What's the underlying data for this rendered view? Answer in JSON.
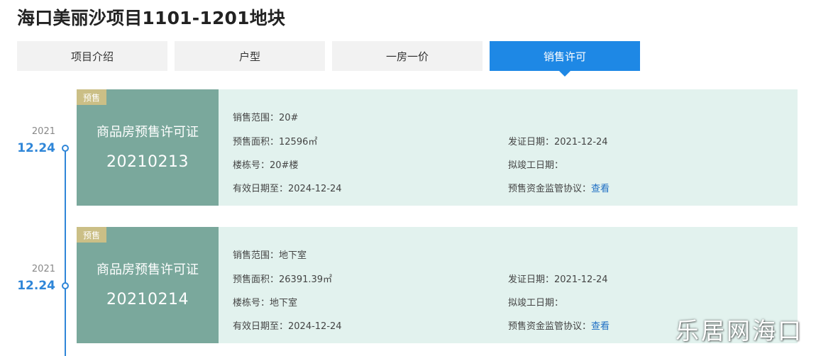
{
  "page": {
    "title": "海口美丽沙项目1101-1201地块"
  },
  "tabs": [
    {
      "label": "项目介绍",
      "active": false
    },
    {
      "label": "户型",
      "active": false
    },
    {
      "label": "一房一价",
      "active": false
    },
    {
      "label": "销售许可",
      "active": true
    }
  ],
  "colors": {
    "accent": "#1e88e5",
    "card_bg": "#e2f2ee",
    "card_left": "#7aa89c",
    "badge": "#cbbf86"
  },
  "permits": [
    {
      "year": "2021",
      "date": "12.24",
      "badge": "预售",
      "cert_name": "商品房预售许可证",
      "cert_no": "20210213",
      "fields": {
        "sales_scope_label": "销售范围：",
        "sales_scope": "20#",
        "presale_area_label": "预售面积：",
        "presale_area": "12596㎡",
        "issue_date_label": "发证日期：",
        "issue_date": "2021-12-24",
        "building_label": "楼栋号：",
        "building": "20#楼",
        "completion_label": "拟竣工日期：",
        "completion": "",
        "valid_until_label": "有效日期至：",
        "valid_until": "2024-12-24",
        "escrow_label": "预售资金监管协议：",
        "escrow_link": "查看"
      }
    },
    {
      "year": "2021",
      "date": "12.24",
      "badge": "预售",
      "cert_name": "商品房预售许可证",
      "cert_no": "20210214",
      "fields": {
        "sales_scope_label": "销售范围：",
        "sales_scope": "地下室",
        "presale_area_label": "预售面积：",
        "presale_area": "26391.39㎡",
        "issue_date_label": "发证日期：",
        "issue_date": "2021-12-24",
        "building_label": "楼栋号：",
        "building": "地下室",
        "completion_label": "拟竣工日期：",
        "completion": "",
        "valid_until_label": "有效日期至：",
        "valid_until": "2024-12-24",
        "escrow_label": "预售资金监管协议：",
        "escrow_link": "查看"
      }
    }
  ],
  "watermark": "乐居网海口"
}
